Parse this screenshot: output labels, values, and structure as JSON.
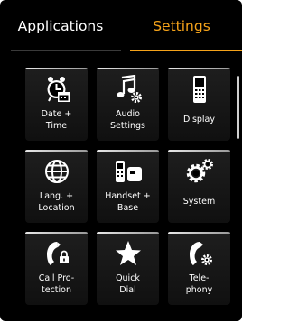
{
  "tabs": {
    "applications": "Applications",
    "settings": "Settings"
  },
  "tiles": [
    {
      "label": "Date +\nTime",
      "icon": "alarm-clock-calendar-icon"
    },
    {
      "label": "Audio\nSettings",
      "icon": "music-note-gear-icon"
    },
    {
      "label": "Display",
      "icon": "mobile-phone-icon"
    },
    {
      "label": "Lang. +\nLocation",
      "icon": "globe-icon"
    },
    {
      "label": "Handset +\nBase",
      "icon": "handset-base-icon"
    },
    {
      "label": "System",
      "icon": "gears-icon"
    },
    {
      "label": "Call Pro-\ntection",
      "icon": "phone-lock-icon"
    },
    {
      "label": "Quick\nDial",
      "icon": "star-icon"
    },
    {
      "label": "Tele-\nphony",
      "icon": "phone-gear-icon"
    }
  ],
  "colors": {
    "accent": "#f5a31a",
    "background": "#000000",
    "tile": "#171717",
    "text": "#ffffff"
  }
}
